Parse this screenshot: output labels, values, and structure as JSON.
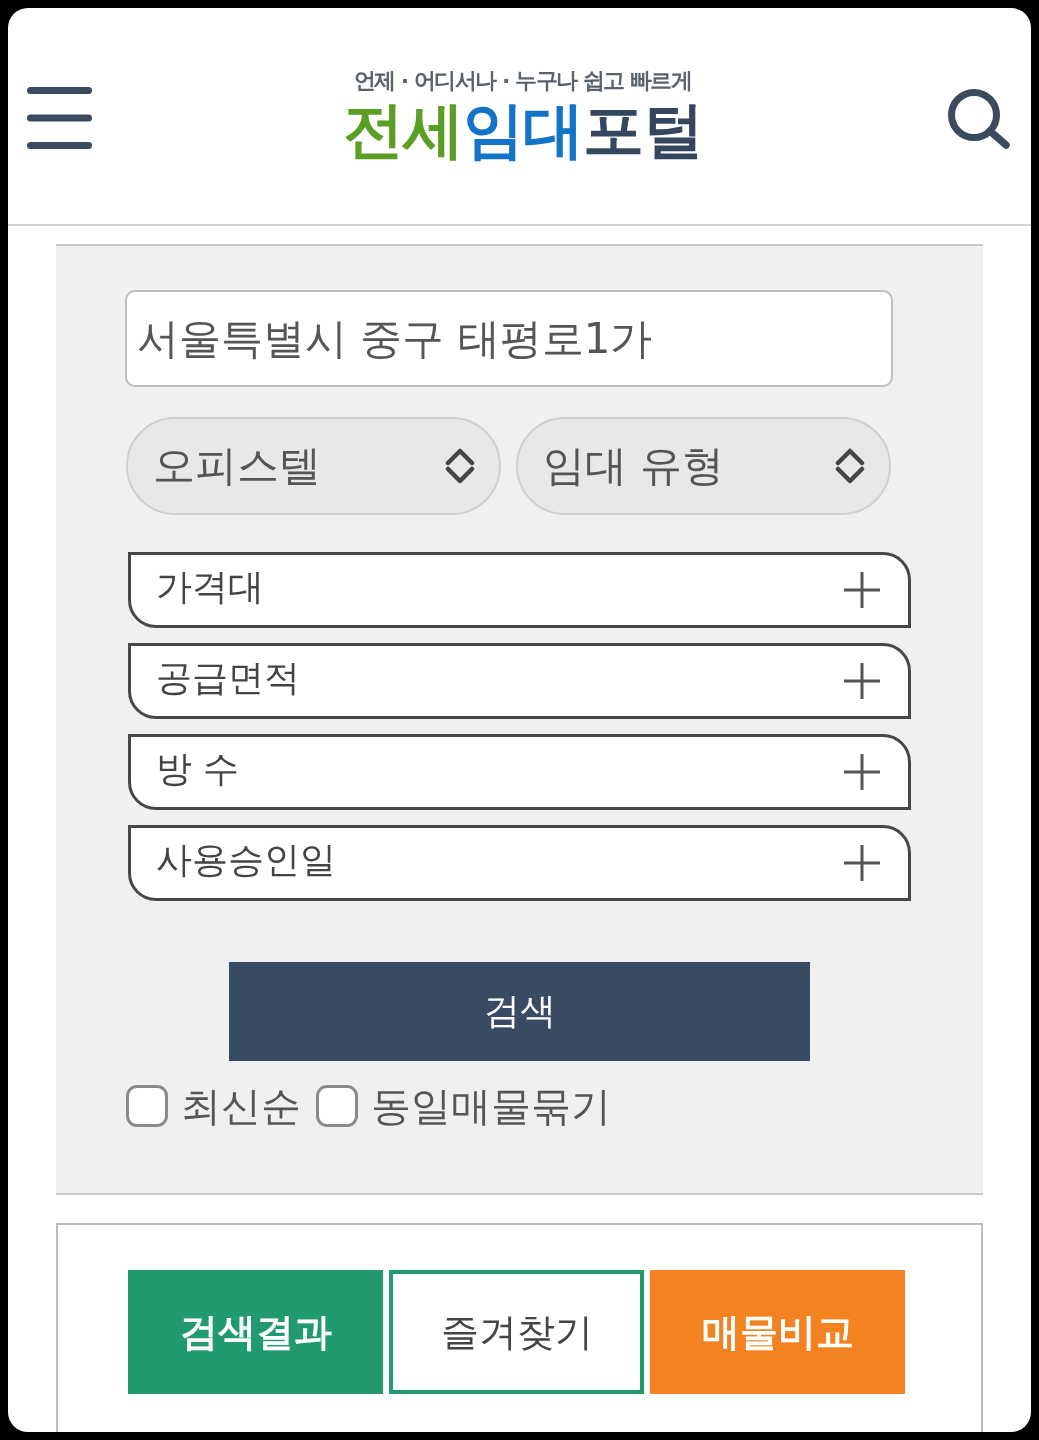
{
  "header": {
    "logo": {
      "tagline": "언제 · 어디서나 · 누구나 쉽고 빠르게",
      "wordmark": [
        {
          "text": "전세",
          "color": "#5a9e23"
        },
        {
          "text": "임대",
          "color": "#1273c9"
        },
        {
          "text": "포털",
          "color": "#34475f"
        }
      ]
    }
  },
  "search_panel": {
    "address": {
      "value": "서울특별시 중구 태평로1가"
    },
    "selects": [
      {
        "value": "오피스텔"
      },
      {
        "value": "임대 유형"
      }
    ],
    "filters": [
      {
        "label": "가격대",
        "expanded": false
      },
      {
        "label": "공급면적",
        "expanded": false
      },
      {
        "label": "방 수",
        "expanded": false
      },
      {
        "label": "사용승인일",
        "expanded": false
      }
    ],
    "search_button": "검색",
    "options": [
      {
        "label": "최신순",
        "checked": false
      },
      {
        "label": "동일매물묶기",
        "checked": false
      }
    ]
  },
  "actions": [
    {
      "label": "검색결과",
      "kind": "solid",
      "color": "#219a6e"
    },
    {
      "label": "즐겨찾기",
      "kind": "outline",
      "color": "#219a6e"
    },
    {
      "label": "매물비교",
      "kind": "solid",
      "color": "#f38220"
    }
  ]
}
